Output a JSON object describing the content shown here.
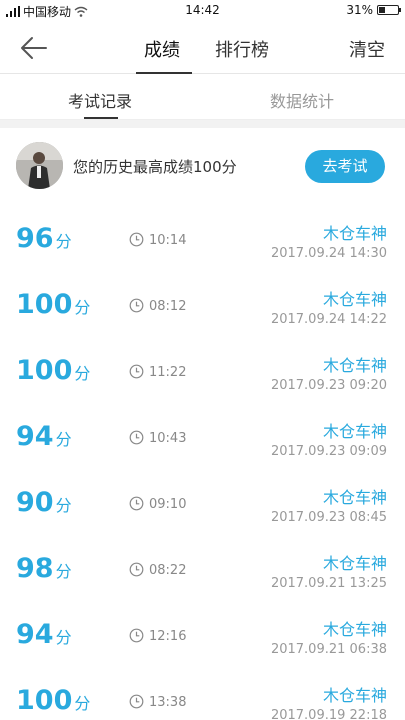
{
  "status_bar": {
    "carrier": "中国移动",
    "time": "14:42",
    "battery": "31%",
    "battery_level": 0.31
  },
  "nav": {
    "tabs": [
      "成绩",
      "排行榜"
    ],
    "clear_label": "清空"
  },
  "sub_tabs": [
    "考试记录",
    "数据统计"
  ],
  "profile": {
    "text": "您的历史最高成绩100分",
    "button_label": "去考试"
  },
  "score_unit": "分",
  "records": [
    {
      "score": "96",
      "duration": "10:14",
      "name": "木仓车神",
      "date": "2017.09.24  14:30"
    },
    {
      "score": "100",
      "duration": "08:12",
      "name": "木仓车神",
      "date": "2017.09.24  14:22"
    },
    {
      "score": "100",
      "duration": "11:22",
      "name": "木仓车神",
      "date": "2017.09.23  09:20"
    },
    {
      "score": "94",
      "duration": "10:43",
      "name": "木仓车神",
      "date": "2017.09.23  09:09"
    },
    {
      "score": "90",
      "duration": "09:10",
      "name": "木仓车神",
      "date": "2017.09.23  08:45"
    },
    {
      "score": "98",
      "duration": "08:22",
      "name": "木仓车神",
      "date": "2017.09.21  13:25"
    },
    {
      "score": "94",
      "duration": "12:16",
      "name": "木仓车神",
      "date": "2017.09.21  06:38"
    },
    {
      "score": "100",
      "duration": "13:38",
      "name": "木仓车神",
      "date": "2017.09.19  22:18"
    }
  ]
}
